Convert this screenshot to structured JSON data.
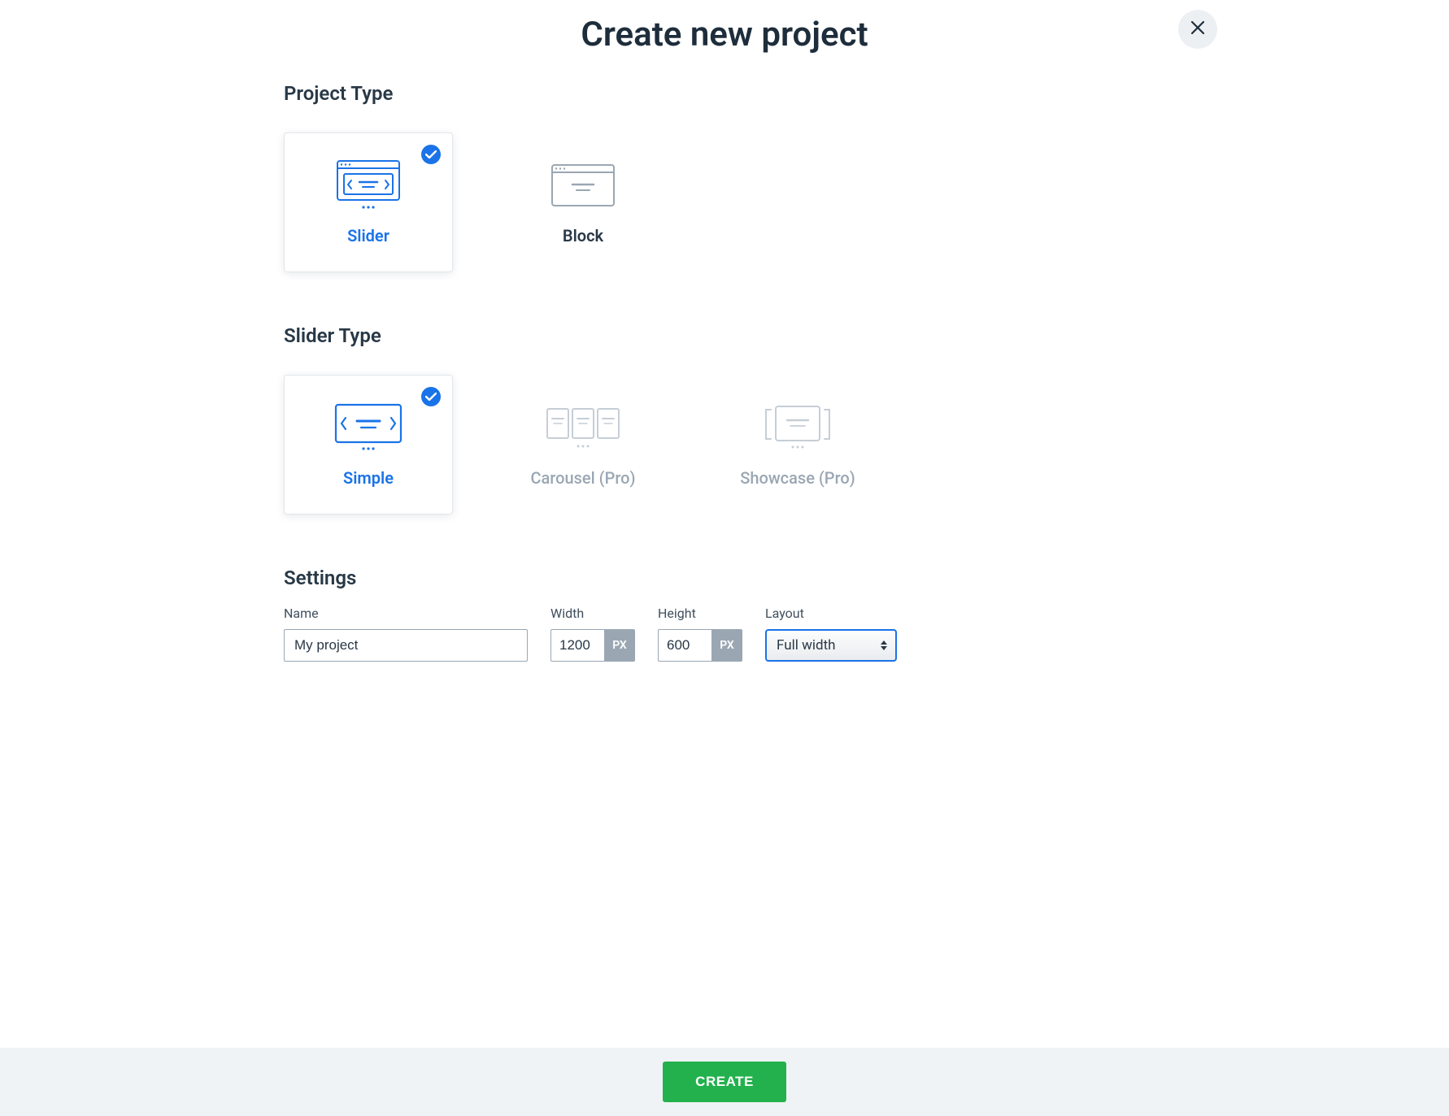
{
  "title": "Create new project",
  "sections": {
    "projectType": {
      "heading": "Project Type",
      "options": [
        {
          "label": "Slider",
          "selected": true
        },
        {
          "label": "Block",
          "selected": false
        }
      ]
    },
    "sliderType": {
      "heading": "Slider Type",
      "options": [
        {
          "label": "Simple",
          "selected": true,
          "disabled": false
        },
        {
          "label": "Carousel (Pro)",
          "selected": false,
          "disabled": true
        },
        {
          "label": "Showcase (Pro)",
          "selected": false,
          "disabled": true
        }
      ]
    },
    "settings": {
      "heading": "Settings",
      "name": {
        "label": "Name",
        "value": "My project"
      },
      "width": {
        "label": "Width",
        "value": "1200",
        "unit": "PX"
      },
      "height": {
        "label": "Height",
        "value": "600",
        "unit": "PX"
      },
      "layout": {
        "label": "Layout",
        "value": "Full width"
      }
    }
  },
  "footer": {
    "create": "CREATE"
  }
}
